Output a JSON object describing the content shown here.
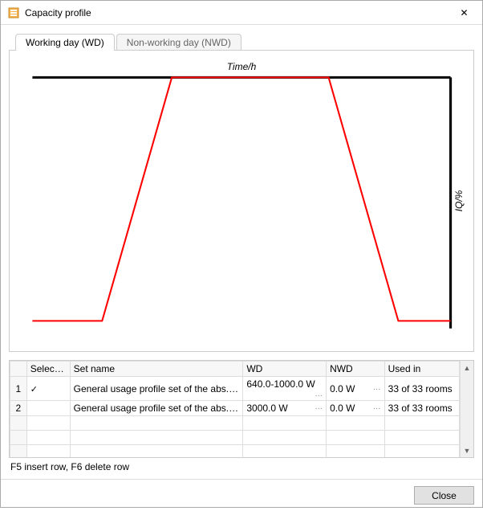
{
  "window": {
    "title": "Capacity profile"
  },
  "tabs": {
    "wd": "Working day (WD)",
    "nwd": "Non-working day (NWD)"
  },
  "chart_data": {
    "type": "line",
    "title": "Time/h",
    "xlabel": "Time/h",
    "ylabel": "IQ/%",
    "xlim": [
      0,
      24
    ],
    "ylim": [
      0,
      100
    ],
    "x": [
      0,
      4,
      8,
      17,
      21,
      24
    ],
    "values": [
      3,
      3,
      100,
      100,
      3,
      3
    ],
    "grid": false,
    "legend": false
  },
  "table": {
    "headers": {
      "selection": "Selection",
      "setname": "Set name",
      "wd": "WD",
      "nwd": "NWD",
      "usedin": "Used in"
    },
    "rows": [
      {
        "n": "1",
        "selected": true,
        "setname": "General usage profile set of the abs. co…",
        "wd": "640.0-1000.0 W",
        "nwd": "0.0 W",
        "usedin": "33 of 33 rooms"
      },
      {
        "n": "2",
        "selected": false,
        "setname": "General usage profile set of the abs. he…",
        "wd": "3000.0 W",
        "nwd": "0.0 W",
        "usedin": "33 of 33 rooms"
      }
    ]
  },
  "hint": "F5 insert row, F6 delete row",
  "buttons": {
    "close": "Close"
  },
  "glyphs": {
    "check": "✓",
    "ellipsis": "…",
    "close_x": "✕",
    "up": "▲",
    "down": "▼"
  }
}
